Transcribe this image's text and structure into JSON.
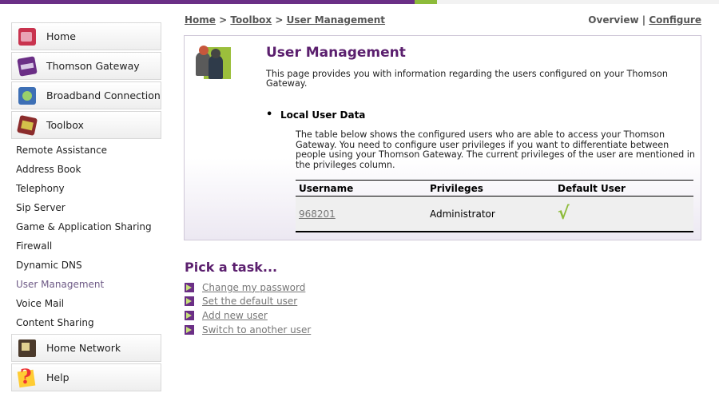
{
  "breadcrumb": {
    "home": "Home",
    "sep1": ">",
    "toolbox": "Toolbox",
    "sep2": ">",
    "current": "User Management"
  },
  "top_nav": {
    "overview": "Overview",
    "divider": "|",
    "configure": "Configure"
  },
  "sidebar": {
    "main_items": [
      {
        "label": "Home",
        "icon": "home-icon"
      },
      {
        "label": "Thomson Gateway",
        "icon": "gateway-icon"
      },
      {
        "label": "Broadband Connection",
        "icon": "broadband-icon"
      },
      {
        "label": "Toolbox",
        "icon": "toolbox-icon"
      }
    ],
    "toolbox_items": [
      "Remote Assistance",
      "Address Book",
      "Telephony",
      "Sip Server",
      "Game & Application Sharing",
      "Firewall",
      "Dynamic DNS",
      "User Management",
      "Voice Mail",
      "Content Sharing"
    ],
    "bottom_items": [
      {
        "label": "Home Network",
        "icon": "home-network-icon"
      },
      {
        "label": "Help",
        "icon": "help-icon"
      }
    ],
    "active_item": "User Management"
  },
  "main": {
    "title": "User Management",
    "intro": "This page provides you with information regarding the users configured on your Thomson Gateway.",
    "section_title": "Local User Data",
    "section_desc": "The table below shows the configured users who are able to access your Thomson Gateway. You need to configure user privileges if you want to differentiate between people using your Thomson Gateway. The current privileges of the user are mentioned in the privileges column.",
    "table": {
      "headers": [
        "Username",
        "Privileges",
        "Default User"
      ],
      "rows": [
        {
          "username": "968201",
          "privileges": "Administrator",
          "default_user": "√"
        }
      ]
    }
  },
  "tasks": {
    "heading": "Pick a task...",
    "items": [
      "Change my password",
      "Set the default user",
      "Add new user",
      "Switch to another user"
    ]
  },
  "colors": {
    "brand_purple": "#6b2f86",
    "title_purple": "#5b1f6e",
    "accent_green": "#8dbb3a"
  }
}
